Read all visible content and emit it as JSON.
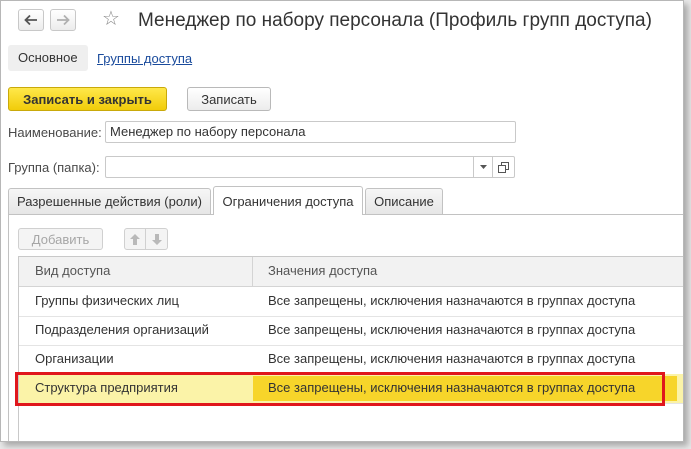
{
  "window": {
    "title": "Менеджер по набору персонала (Профиль групп доступа)"
  },
  "nav": {
    "main_tab": "Основное",
    "groups_link": "Группы доступа"
  },
  "toolbar": {
    "save_close_label": "Записать и закрыть",
    "save_label": "Записать"
  },
  "form": {
    "name_label": "Наименование:",
    "name_value": "Менеджер по набору персонала",
    "group_label": "Группа (папка):",
    "group_value": ""
  },
  "tabs": [
    {
      "label": "Разрешенные действия (роли)"
    },
    {
      "label": "Ограничения доступа",
      "active": true
    },
    {
      "label": "Описание"
    }
  ],
  "table_toolbar": {
    "add_label": "Добавить"
  },
  "table": {
    "columns": [
      "Вид доступа",
      "Значения доступа"
    ],
    "rows": [
      {
        "type": "Группы физических лиц",
        "value": "Все запрещены, исключения назначаются в группах доступа"
      },
      {
        "type": "Подразделения организаций",
        "value": "Все запрещены, исключения назначаются в группах доступа"
      },
      {
        "type": "Организации",
        "value": "Все запрещены, исключения назначаются в группах доступа"
      },
      {
        "type": "Структура предприятия",
        "value": "Все запрещены, исключения назначаются в группах доступа",
        "selected": true
      }
    ]
  },
  "colors": {
    "accent_yellow": "#f1cc0a",
    "highlight_border": "#e0161c",
    "link_blue": "#1a4b9c"
  }
}
